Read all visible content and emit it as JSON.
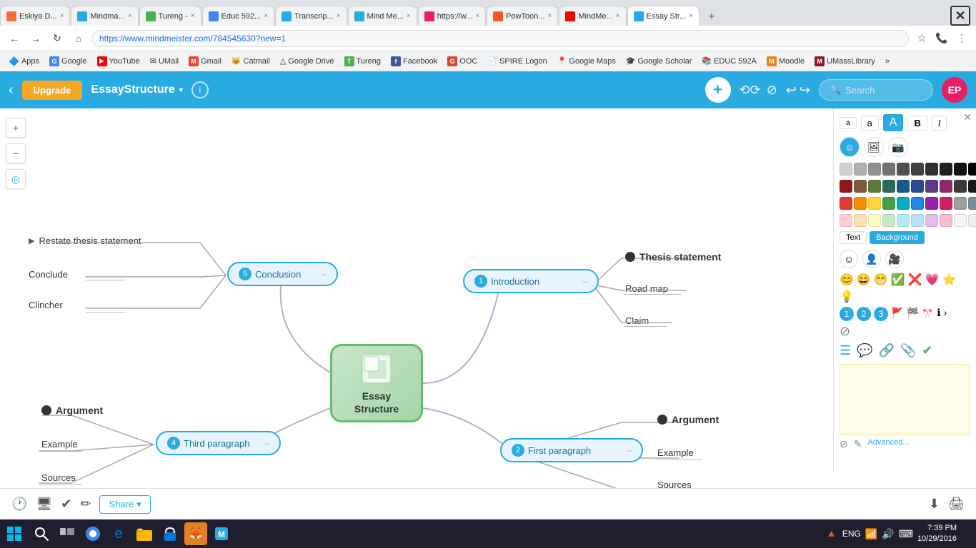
{
  "browser": {
    "tabs": [
      {
        "label": "Eskiya D...",
        "icon_color": "#ff6b35",
        "active": false
      },
      {
        "label": "Mindma...",
        "icon_color": "#29abe2",
        "active": false
      },
      {
        "label": "Tureng -",
        "icon_color": "#4caf50",
        "active": false
      },
      {
        "label": "Educ 592...",
        "icon_color": "#4285f4",
        "active": false
      },
      {
        "label": "Transcrip...",
        "icon_color": "#29abe2",
        "active": false
      },
      {
        "label": "Mind Me...",
        "icon_color": "#29abe2",
        "active": false
      },
      {
        "label": "https://w...",
        "icon_color": "#e91e63",
        "active": false
      },
      {
        "label": "PowToon...",
        "icon_color": "#ff5722",
        "active": false
      },
      {
        "label": "MindMe...",
        "icon_color": "#ff0000",
        "active": false
      },
      {
        "label": "Essay Str...",
        "icon_color": "#29abe2",
        "active": true
      }
    ],
    "address": "https://www.mindmeister.com/784545630?new=1",
    "bookmarks": [
      {
        "label": "Apps",
        "icon": "🔷"
      },
      {
        "label": "Google",
        "icon": "🅶"
      },
      {
        "label": "YouTube",
        "icon": "▶"
      },
      {
        "label": "UMail",
        "icon": "✉"
      },
      {
        "label": "Gmail",
        "icon": "M"
      },
      {
        "label": "Catmail",
        "icon": "🐱"
      },
      {
        "label": "Google Drive",
        "icon": "△"
      },
      {
        "label": "Tureng",
        "icon": "T"
      },
      {
        "label": "Facebook",
        "icon": "f"
      },
      {
        "label": "OOC",
        "icon": "G"
      },
      {
        "label": "SPIRE Logon",
        "icon": "📄"
      },
      {
        "label": "Google Maps",
        "icon": "📍"
      },
      {
        "label": "Google Scholar",
        "icon": "🎓"
      },
      {
        "label": "EDUC 592A",
        "icon": "📚"
      },
      {
        "label": "Moodle",
        "icon": "M"
      },
      {
        "label": "UMassLibrary",
        "icon": "M"
      }
    ]
  },
  "toolbar": {
    "upgrade_label": "Upgrade",
    "app_title": "EssayStructure",
    "search_placeholder": "Search",
    "avatar_label": "EP"
  },
  "mindmap": {
    "center_node": "Essay\nStructure",
    "nodes": {
      "introduction": {
        "num": "1",
        "label": "Introduction"
      },
      "conclusion": {
        "num": "5",
        "label": "Conclusion"
      },
      "first_paragraph": {
        "num": "2",
        "label": "First paragraph"
      },
      "third_paragraph": {
        "num": "4",
        "label": "Third paragraph"
      },
      "intro_children": [
        "Thesis statement",
        "Road map",
        "Claim"
      ],
      "conclusion_children": [
        "Restate thesis statement",
        "Conclude",
        "Clincher"
      ],
      "first_para_children": [
        "Argument",
        "Example",
        "Sources"
      ],
      "third_para_children": [
        "Argument",
        "Example",
        "Sources"
      ]
    }
  },
  "right_panel": {
    "text_styles": [
      "a",
      "a",
      "A",
      "B",
      "I"
    ],
    "text_label": "Text",
    "background_label": "Background",
    "advanced_label": "Advanced..."
  },
  "bottom_toolbar": {
    "share_label": "Share"
  },
  "taskbar": {
    "time": "7:39 PM",
    "date": "10/29/2016"
  },
  "colors": {
    "primary": "#29abe2",
    "upgrade": "#f5a623",
    "center_node_bg": "#c8e6c9",
    "center_node_border": "#66bb6a"
  }
}
